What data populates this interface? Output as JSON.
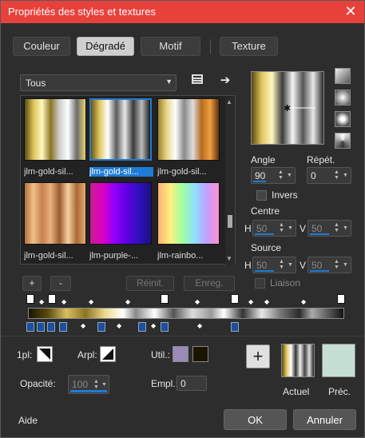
{
  "window": {
    "title": "Propriétés des styles et textures",
    "close": "✕"
  },
  "tabs": [
    "Couleur",
    "Dégradé",
    "Motif",
    "Texture"
  ],
  "filter": {
    "value": "Tous"
  },
  "gallery": {
    "items": [
      {
        "label": "jlm-gold-sil..."
      },
      {
        "label": "jlm-gold-sil..."
      },
      {
        "label": "jlm-gold-sil..."
      },
      {
        "label": "jlm-gold-sil..."
      },
      {
        "label": "jlm-purple-..."
      },
      {
        "label": "jlm-rainbo..."
      }
    ]
  },
  "gallery_buttons": {
    "add": "+",
    "remove": "-",
    "reset": "Réinit.",
    "save": "Enreg."
  },
  "angle": {
    "label": "Angle",
    "value": "90"
  },
  "repeat": {
    "label": "Répét.",
    "value": "0"
  },
  "invert": {
    "label": "Invers"
  },
  "center": {
    "label": "Centre",
    "h_label": "H",
    "h_value": "50",
    "v_label": "V",
    "v_value": "50"
  },
  "source": {
    "label": "Source",
    "h_label": "H",
    "h_value": "50",
    "v_label": "V",
    "v_value": "50"
  },
  "link": {
    "label": "Liaison"
  },
  "bottom": {
    "fg_label": "1pl:",
    "bg_label": "Arpl:",
    "user_label": "Util.:",
    "opacity_label": "Opacité:",
    "opacity_value": "100",
    "location_label": "Empl.:",
    "location_value": "0",
    "current_label": "Actuel",
    "previous_label": "Préc.",
    "add_symbol": "+"
  },
  "footer": {
    "help": "Aide",
    "ok": "OK",
    "cancel": "Annuler"
  },
  "colors": {
    "accent": "#1e7bd6",
    "title_bar": "#e8413c",
    "ok": "#555555",
    "previous_swatch": "#c5dfd2",
    "user_color": "#9a8ab8"
  }
}
